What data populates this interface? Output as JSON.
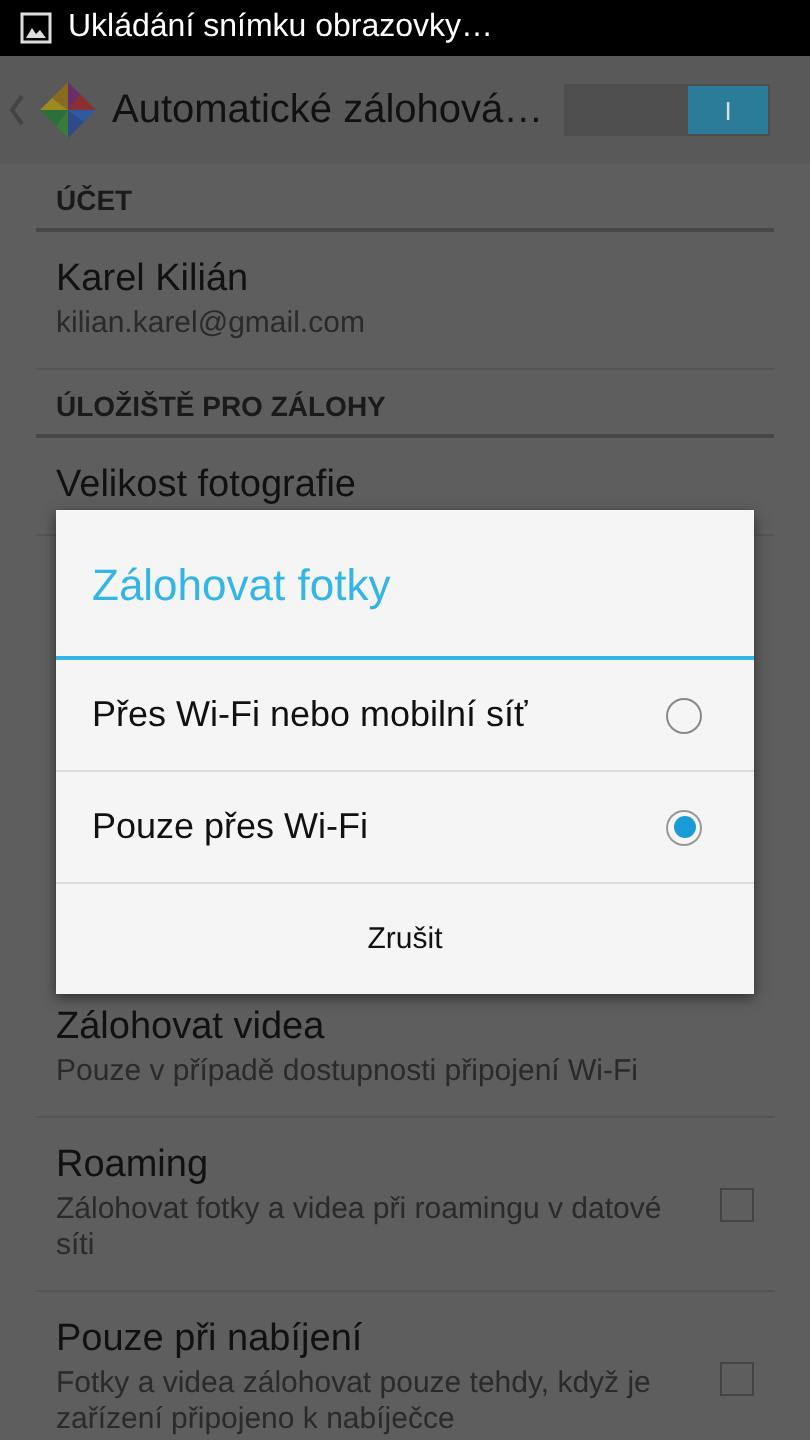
{
  "status_bar": {
    "notification": "Ukládání snímku obrazovky…"
  },
  "action_bar": {
    "title": "Automatické zálohová…",
    "switch": {
      "on": true,
      "label": "I"
    }
  },
  "sections": [
    {
      "header": "ÚČET",
      "items": [
        {
          "title": "Karel Kilián",
          "summary": "kilian.karel@gmail.com"
        }
      ]
    },
    {
      "header": "ÚLOŽIŠTĚ PRO ZÁLOHY",
      "items": [
        {
          "title": "Velikost fotografie"
        }
      ]
    }
  ],
  "more_items": [
    {
      "title": "Zálohovat videa",
      "summary": "Pouze v případě dostupnosti připojení Wi-Fi"
    },
    {
      "title": "Roaming",
      "summary": "Zálohovat fotky a videa při roamingu v datové síti",
      "kind": "checkbox",
      "checked": false
    },
    {
      "title": "Pouze při nabíjení",
      "summary": "Fotky a videa zálohovat pouze tehdy, když je zařízení připojeno k nabíječce",
      "kind": "checkbox",
      "checked": false
    }
  ],
  "dialog": {
    "title": "Zálohovat fotky",
    "options": [
      {
        "label": "Přes Wi-Fi nebo mobilní síť",
        "selected": false
      },
      {
        "label": "Pouze přes Wi-Fi",
        "selected": true
      }
    ],
    "cancel": "Zrušit"
  }
}
